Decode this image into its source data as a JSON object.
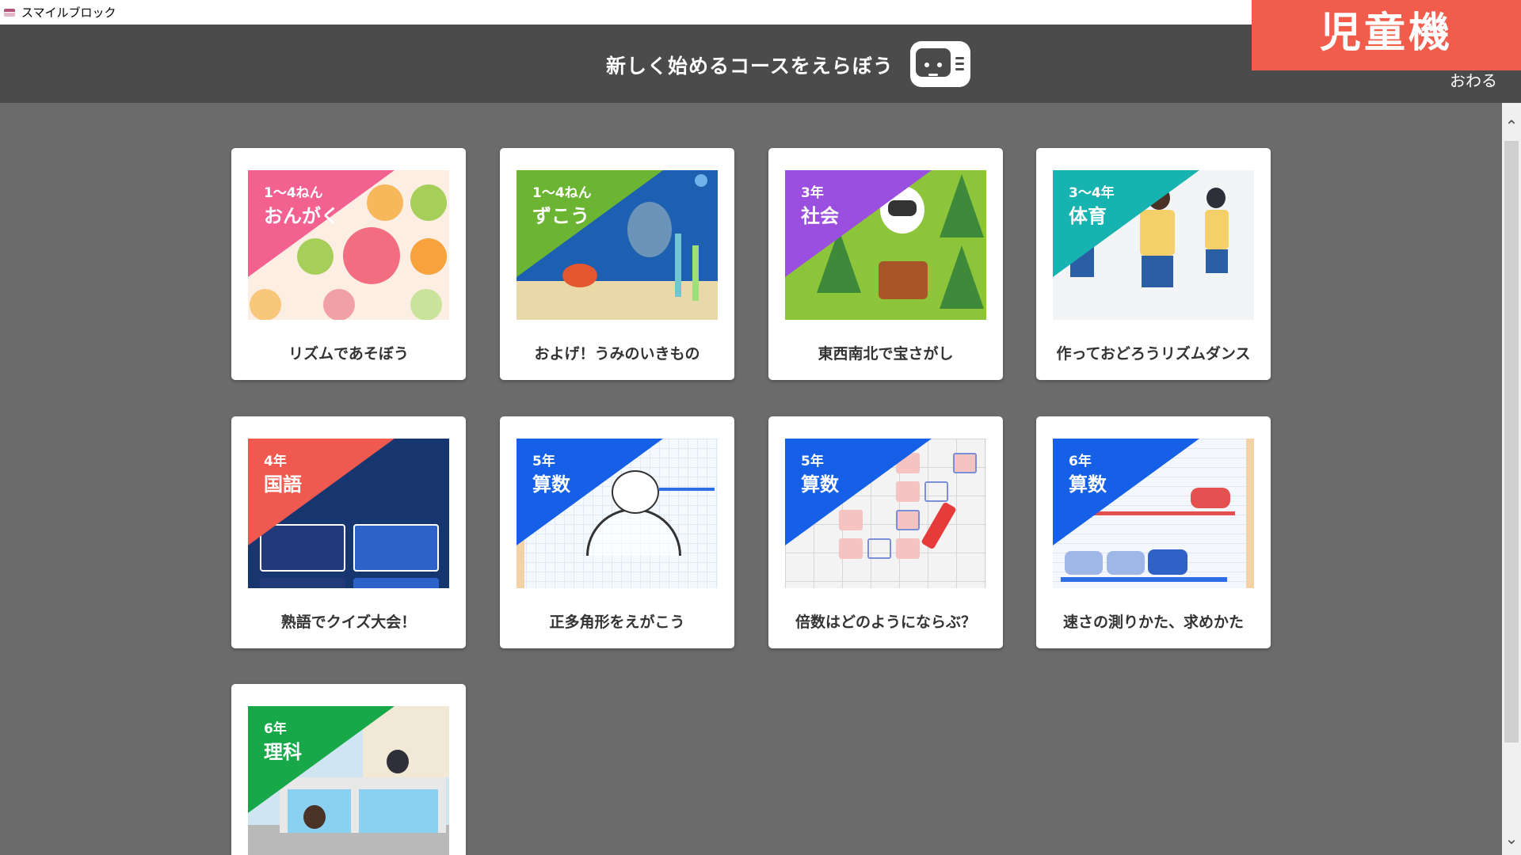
{
  "window": {
    "title": "スマイルブロック"
  },
  "header": {
    "title": "新しく始めるコースをえらぼう",
    "quit_label": "おわる"
  },
  "badge": "児童機",
  "courses": [
    {
      "grade": "1〜4ねん",
      "subject": "おんがく",
      "title": "リズムであそぼう",
      "accent": "#f2618f",
      "bg": "#fdeee4"
    },
    {
      "grade": "1〜4ねん",
      "subject": "ずこう",
      "title": "およげ！うみのいきもの",
      "accent": "#6cb533",
      "bg": "#1d5fb0"
    },
    {
      "grade": "3年",
      "subject": "社会",
      "title": "東西南北で宝さがし",
      "accent": "#9b4fde",
      "bg": "#8cc43a"
    },
    {
      "grade": "3〜4年",
      "subject": "体育",
      "title": "作っておどろうリズムダンス",
      "accent": "#17b3b0",
      "bg": "#f2f4f6"
    },
    {
      "grade": "4年",
      "subject": "国語",
      "title": "熟語でクイズ大会！",
      "accent": "#f0594f",
      "bg": "#17356f"
    },
    {
      "grade": "5年",
      "subject": "算数",
      "title": "正多角形をえがこう",
      "accent": "#1560e6",
      "bg": "#f4f9fd"
    },
    {
      "grade": "5年",
      "subject": "算数",
      "title": "倍数はどのようにならぶ？",
      "accent": "#1560e6",
      "bg": "#f3f3f3"
    },
    {
      "grade": "6年",
      "subject": "算数",
      "title": "速さの測りかた、求めかた",
      "accent": "#1560e6",
      "bg": "#f4f8fc"
    },
    {
      "grade": "6年",
      "subject": "理科",
      "title": "",
      "accent": "#18a84a",
      "bg": "#cfe6f2"
    }
  ]
}
